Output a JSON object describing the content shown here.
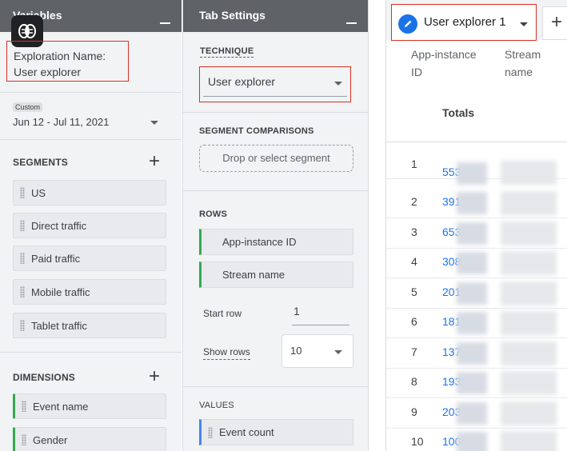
{
  "variables": {
    "title": "Variables",
    "exploration_name_label": "Exploration Name:",
    "exploration_name_value": "User explorer",
    "date_chip": "Custom",
    "date_range": "Jun 12 - Jul 11, 2021",
    "segments_label": "SEGMENTS",
    "segments": [
      "US",
      "Direct traffic",
      "Paid traffic",
      "Mobile traffic",
      "Tablet traffic"
    ],
    "dimensions_label": "DIMENSIONS",
    "dimensions": [
      "Event name",
      "Gender"
    ]
  },
  "tab_settings": {
    "title": "Tab Settings",
    "technique_label": "TECHNIQUE",
    "technique_value": "User explorer",
    "segment_comparisons_label": "SEGMENT COMPARISONS",
    "drop_segment_label": "Drop or select segment",
    "rows_label": "ROWS",
    "rows": [
      "App-instance ID",
      "Stream name"
    ],
    "start_row_label": "Start row",
    "start_row_value": "1",
    "show_rows_label": "Show rows",
    "show_rows_value": "10",
    "values_label": "VALUES",
    "values": [
      "Event count"
    ]
  },
  "report": {
    "tab_label": "User explorer 1",
    "add_tab_symbol": "+",
    "columns": [
      {
        "line1": "App-instance",
        "line2": "ID"
      },
      {
        "line1": "Stream",
        "line2": "name"
      }
    ],
    "totals_label": "Totals",
    "rows": [
      {
        "num": "1",
        "id": "553"
      },
      {
        "num": "2",
        "id": "391"
      },
      {
        "num": "3",
        "id": "653"
      },
      {
        "num": "4",
        "id": "308"
      },
      {
        "num": "5",
        "id": "201"
      },
      {
        "num": "6",
        "id": "181"
      },
      {
        "num": "7",
        "id": "137"
      },
      {
        "num": "8",
        "id": "193"
      },
      {
        "num": "9",
        "id": "203"
      },
      {
        "num": "10",
        "id": "100"
      }
    ]
  },
  "icons": {
    "brain": "brain-icon",
    "pencil": "pencil-icon",
    "drag": "drag-handle-icon"
  },
  "colors": {
    "highlight_red": "#d93025",
    "accent_blue": "#1a73e8",
    "dimension_green": "#34a853",
    "header_gray": "#5f6368"
  }
}
